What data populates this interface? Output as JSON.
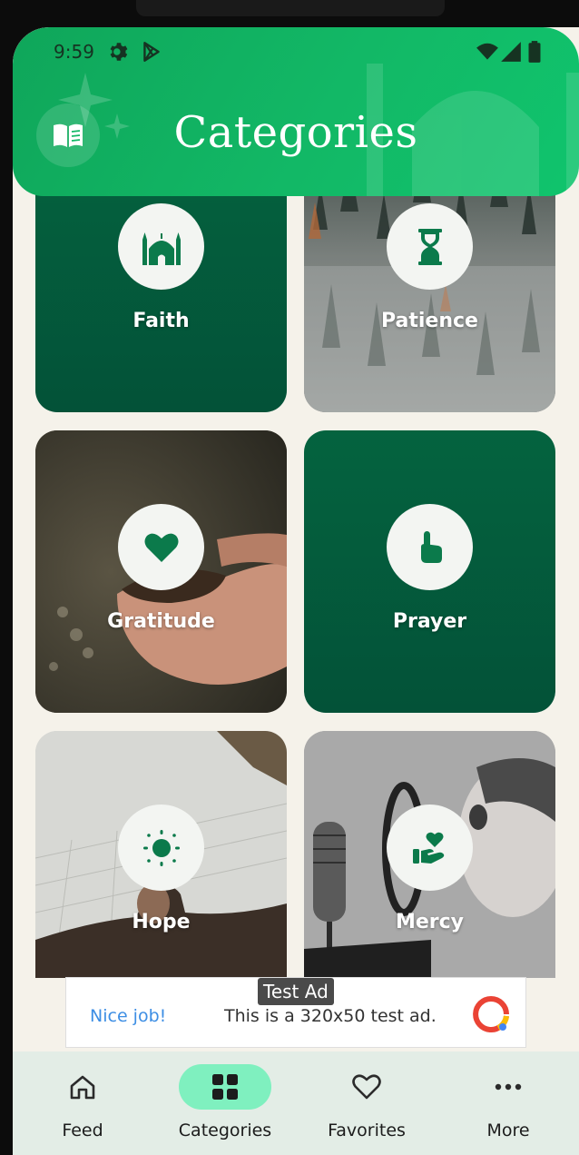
{
  "status_bar": {
    "time": "9:59",
    "left_icons": [
      "gear-icon",
      "play-store-icon"
    ],
    "right_icons": [
      "wifi-icon",
      "signal-icon",
      "battery-icon"
    ]
  },
  "header": {
    "title": "Categories",
    "left_button_icon": "book-icon",
    "background_color": "#12b866"
  },
  "categories": [
    {
      "label": "Faith",
      "icon": "mosque-icon",
      "background": "green"
    },
    {
      "label": "Patience",
      "icon": "hourglass-icon",
      "background": "photo-foggy-forest"
    },
    {
      "label": "Gratitude",
      "icon": "heart-icon",
      "background": "photo-hands-with-soil"
    },
    {
      "label": "Prayer",
      "icon": "pointing-hand-icon",
      "background": "green"
    },
    {
      "label": "Hope",
      "icon": "sun-icon",
      "background": "photo-man-arms-raised"
    },
    {
      "label": "Mercy",
      "icon": "hand-heart-icon",
      "background": "photo-boy-shouting-microphone"
    }
  ],
  "ad": {
    "tag": "Test Ad",
    "headline": "Nice job!",
    "body": "This is a 320x50 test ad."
  },
  "bottom_nav": [
    {
      "label": "Feed",
      "icon": "home-icon",
      "active": false
    },
    {
      "label": "Categories",
      "icon": "grid-icon",
      "active": true
    },
    {
      "label": "Favorites",
      "icon": "heart-outline-icon",
      "active": false
    },
    {
      "label": "More",
      "icon": "more-dots-icon",
      "active": false
    }
  ],
  "colors": {
    "accent": "#12b866",
    "card_green": "#035a3d",
    "icon_green": "#0b7a4b",
    "active_pill": "#7ff0bf"
  }
}
